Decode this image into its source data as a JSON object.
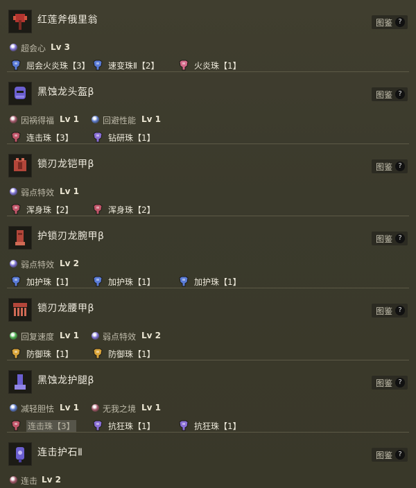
{
  "header": {
    "tujian_label": "图鉴",
    "help_glyph": "?"
  },
  "colors": {
    "skill_purple": "#7b6fd0",
    "skill_red": "#a3586a",
    "skill_blue": "#5a78c8",
    "skill_green": "#4caf50",
    "gem_red": "#c2566a",
    "gem_blue": "#5a7bd6",
    "gem_purple": "#8a6fd6",
    "gem_gold": "#d9a43a",
    "gem_pink": "#d46a8a"
  },
  "items": [
    {
      "name": "红莲斧俄里翁",
      "icon": "red-lotus-axe-icon",
      "skills": [
        {
          "name": "超会心",
          "lv": "Lv 3",
          "icon": "purple-skill-icon"
        }
      ],
      "gems": [
        {
          "name": "屈会火炎珠【3】",
          "icon": "blue-gem-icon"
        },
        {
          "name": "速变珠Ⅱ【2】",
          "icon": "blue-gem-icon"
        },
        {
          "name": "火炎珠【1】",
          "icon": "pink-gem-icon"
        }
      ]
    },
    {
      "name": "黑蚀龙头盔β",
      "icon": "gore-helm-icon",
      "skills": [
        {
          "name": "因祸得福",
          "lv": "Lv 1",
          "icon": "red-skill-icon"
        },
        {
          "name": "回避性能",
          "lv": "Lv 1",
          "icon": "blue-skill-icon"
        }
      ],
      "gems": [
        {
          "name": "连击珠【3】",
          "icon": "red-gem-icon"
        },
        {
          "name": "钻研珠【1】",
          "icon": "purple-gem-icon"
        }
      ]
    },
    {
      "name": "锁刃龙铠甲β",
      "icon": "odogaron-mail-icon",
      "skills": [
        {
          "name": "弱点特效",
          "lv": "Lv 1",
          "icon": "purple-skill-icon"
        }
      ],
      "gems": [
        {
          "name": "浑身珠【2】",
          "icon": "red-gem-icon"
        },
        {
          "name": "浑身珠【2】",
          "icon": "red-gem-icon"
        }
      ]
    },
    {
      "name": "护锁刃龙腕甲β",
      "icon": "odogaron-vambraces-icon",
      "skills": [
        {
          "name": "弱点特效",
          "lv": "Lv 2",
          "icon": "purple-skill-icon"
        }
      ],
      "gems": [
        {
          "name": "加护珠【1】",
          "icon": "blue-gem-icon"
        },
        {
          "name": "加护珠【1】",
          "icon": "blue-gem-icon"
        },
        {
          "name": "加护珠【1】",
          "icon": "blue-gem-icon"
        }
      ]
    },
    {
      "name": "锁刃龙腰甲β",
      "icon": "odogaron-coil-icon",
      "skills": [
        {
          "name": "回复速度",
          "lv": "Lv 1",
          "icon": "green-skill-icon"
        },
        {
          "name": "弱点特效",
          "lv": "Lv 2",
          "icon": "purple-skill-icon"
        }
      ],
      "gems": [
        {
          "name": "防御珠【1】",
          "icon": "gold-gem-icon"
        },
        {
          "name": "防御珠【1】",
          "icon": "gold-gem-icon"
        }
      ]
    },
    {
      "name": "黑蚀龙护腿β",
      "icon": "gore-greaves-icon",
      "skills": [
        {
          "name": "减轻胆怯",
          "lv": "Lv 1",
          "icon": "blue-skill-icon"
        },
        {
          "name": "无我之境",
          "lv": "Lv 1",
          "icon": "red-skill-icon"
        }
      ],
      "gems": [
        {
          "name": "连击珠【3】",
          "icon": "red-gem-icon",
          "highlighted": true
        },
        {
          "name": "抗狂珠【1】",
          "icon": "purple-gem-icon"
        },
        {
          "name": "抗狂珠【1】",
          "icon": "purple-gem-icon"
        }
      ]
    },
    {
      "name": "连击护石Ⅱ",
      "icon": "charm-icon",
      "skills": [
        {
          "name": "连击",
          "lv": "Lv 2",
          "icon": "red-skill-icon"
        }
      ],
      "gems": []
    }
  ]
}
